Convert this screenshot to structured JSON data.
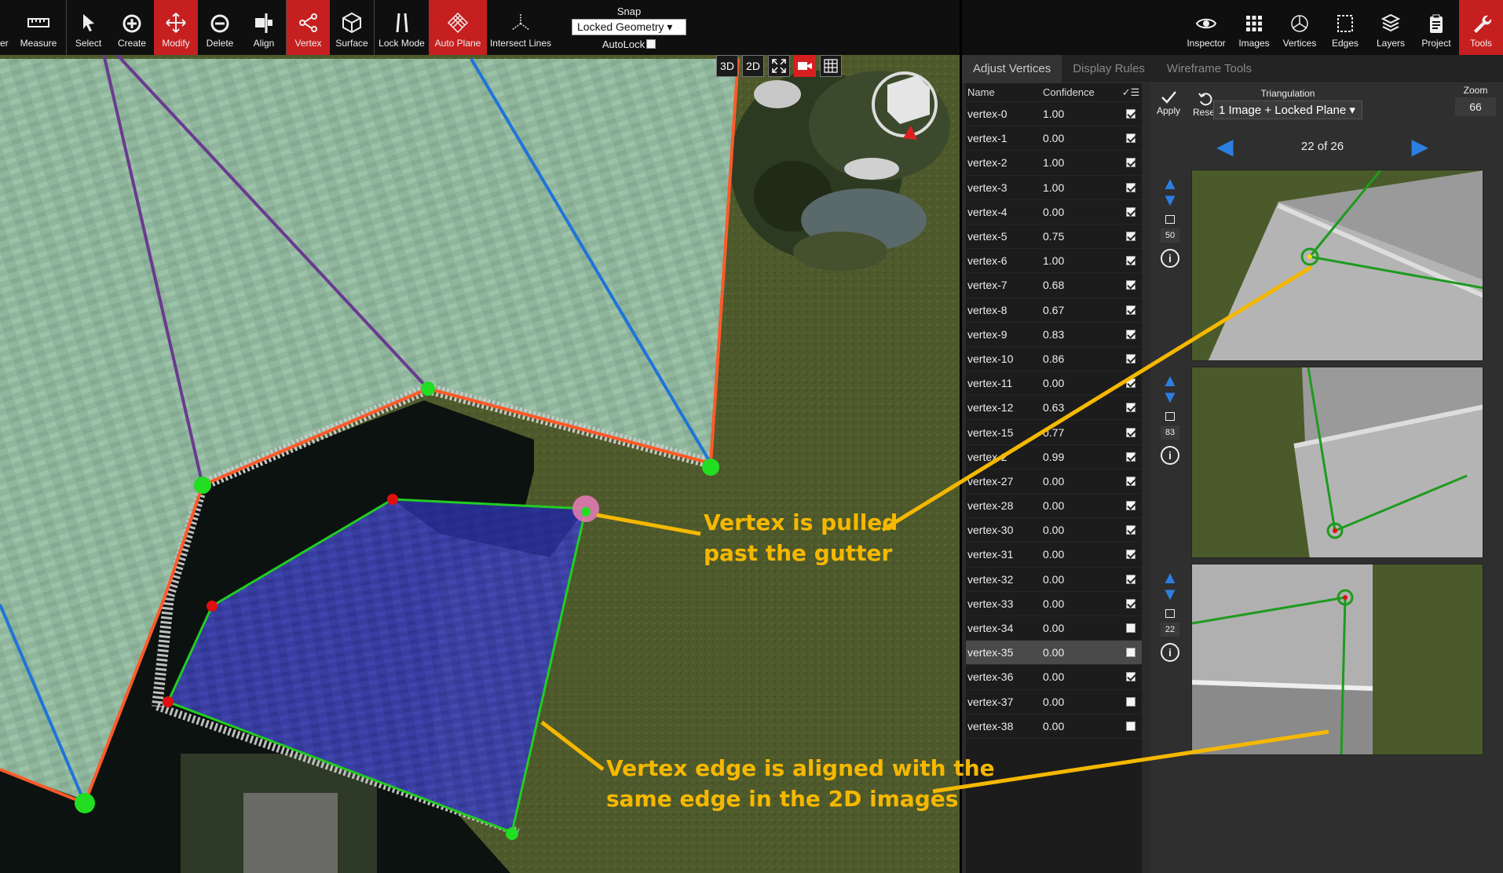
{
  "toolbar": {
    "items": [
      {
        "label": "er",
        "icon": "truncated-icon"
      },
      {
        "label": "Measure",
        "icon": "ruler-icon"
      },
      {
        "label": "Select",
        "icon": "cursor-icon"
      },
      {
        "label": "Create",
        "icon": "plus-circle-icon"
      },
      {
        "label": "Modify",
        "icon": "move-icon",
        "active": true
      },
      {
        "label": "Delete",
        "icon": "minus-circle-icon"
      },
      {
        "label": "Align",
        "icon": "align-icon"
      },
      {
        "label": "Vertex",
        "icon": "vertex-icon",
        "active": true
      },
      {
        "label": "Surface",
        "icon": "cube-icon"
      },
      {
        "label": "Lock Mode",
        "icon": "lock-mode-icon"
      },
      {
        "label": "Auto Plane",
        "icon": "auto-plane-icon",
        "active": true
      },
      {
        "label": "Intersect Lines",
        "icon": "intersect-icon"
      }
    ],
    "snap_label": "Snap",
    "snap_value": "Locked Geometry",
    "autolock_label": "AutoLock"
  },
  "view_buttons": {
    "b3d": "3D",
    "b2d": "2D"
  },
  "right_toolbar": {
    "items": [
      {
        "label": "Inspector",
        "icon": "eye-icon"
      },
      {
        "label": "Images",
        "icon": "grid-icon"
      },
      {
        "label": "Vertices",
        "icon": "vertices-icon"
      },
      {
        "label": "Edges",
        "icon": "edges-icon"
      },
      {
        "label": "Layers",
        "icon": "layers-icon"
      },
      {
        "label": "Project",
        "icon": "clipboard-icon"
      },
      {
        "label": "Tools",
        "icon": "wrench-icon",
        "active": true
      }
    ]
  },
  "tabs": [
    "Adjust Vertices",
    "Display Rules",
    "Wireframe Tools"
  ],
  "table": {
    "col_name": "Name",
    "col_conf": "Confidence",
    "col_check": "✓",
    "rows": [
      {
        "name": "vertex-0",
        "conf": "1.00",
        "checked": true
      },
      {
        "name": "vertex-1",
        "conf": "0.00",
        "checked": true
      },
      {
        "name": "vertex-2",
        "conf": "1.00",
        "checked": true
      },
      {
        "name": "vertex-3",
        "conf": "1.00",
        "checked": true
      },
      {
        "name": "vertex-4",
        "conf": "0.00",
        "checked": true
      },
      {
        "name": "vertex-5",
        "conf": "0.75",
        "checked": true
      },
      {
        "name": "vertex-6",
        "conf": "1.00",
        "checked": true
      },
      {
        "name": "vertex-7",
        "conf": "0.68",
        "checked": true
      },
      {
        "name": "vertex-8",
        "conf": "0.67",
        "checked": true
      },
      {
        "name": "vertex-9",
        "conf": "0.83",
        "checked": true
      },
      {
        "name": "vertex-10",
        "conf": "0.86",
        "checked": true
      },
      {
        "name": "vertex-11",
        "conf": "0.00",
        "checked": true
      },
      {
        "name": "vertex-12",
        "conf": "0.63",
        "checked": true
      },
      {
        "name": "vertex-15",
        "conf": "0.77",
        "checked": true
      },
      {
        "name": "vertex-2",
        "conf": "0.99",
        "checked": true
      },
      {
        "name": "vertex-27",
        "conf": "0.00",
        "checked": true
      },
      {
        "name": "vertex-28",
        "conf": "0.00",
        "checked": true
      },
      {
        "name": "vertex-30",
        "conf": "0.00",
        "checked": true
      },
      {
        "name": "vertex-31",
        "conf": "0.00",
        "checked": true
      },
      {
        "name": "vertex-32",
        "conf": "0.00",
        "checked": true
      },
      {
        "name": "vertex-33",
        "conf": "0.00",
        "checked": true
      },
      {
        "name": "vertex-34",
        "conf": "0.00",
        "checked": false
      },
      {
        "name": "vertex-35",
        "conf": "0.00",
        "checked": false,
        "selected": true
      },
      {
        "name": "vertex-36",
        "conf": "0.00",
        "checked": true
      },
      {
        "name": "vertex-37",
        "conf": "0.00",
        "checked": false
      },
      {
        "name": "vertex-38",
        "conf": "0.00",
        "checked": false
      }
    ]
  },
  "image_panel": {
    "apply": "Apply",
    "reset": "Reset",
    "triangulation_label": "Triangulation",
    "triangulation_value": "1 Image + Locked Plane",
    "zoom_label": "Zoom",
    "zoom_value": "66",
    "pager": "22 of 26",
    "thumb_counts": [
      "50",
      "83",
      "22"
    ]
  },
  "callouts": {
    "pulled_line1": "Vertex is pulled",
    "pulled_line2": "past the gutter",
    "aligned_line1": "Vertex edge is aligned with the",
    "aligned_line2": "same edge in the 2D images"
  },
  "colors": {
    "accent_red": "#c61f1f",
    "callout": "#f5b800",
    "edge_green": "#22cc22",
    "edge_orange": "#ff5a2a",
    "edge_blue": "#1e74d8",
    "edge_purple": "#6b3a8f"
  }
}
